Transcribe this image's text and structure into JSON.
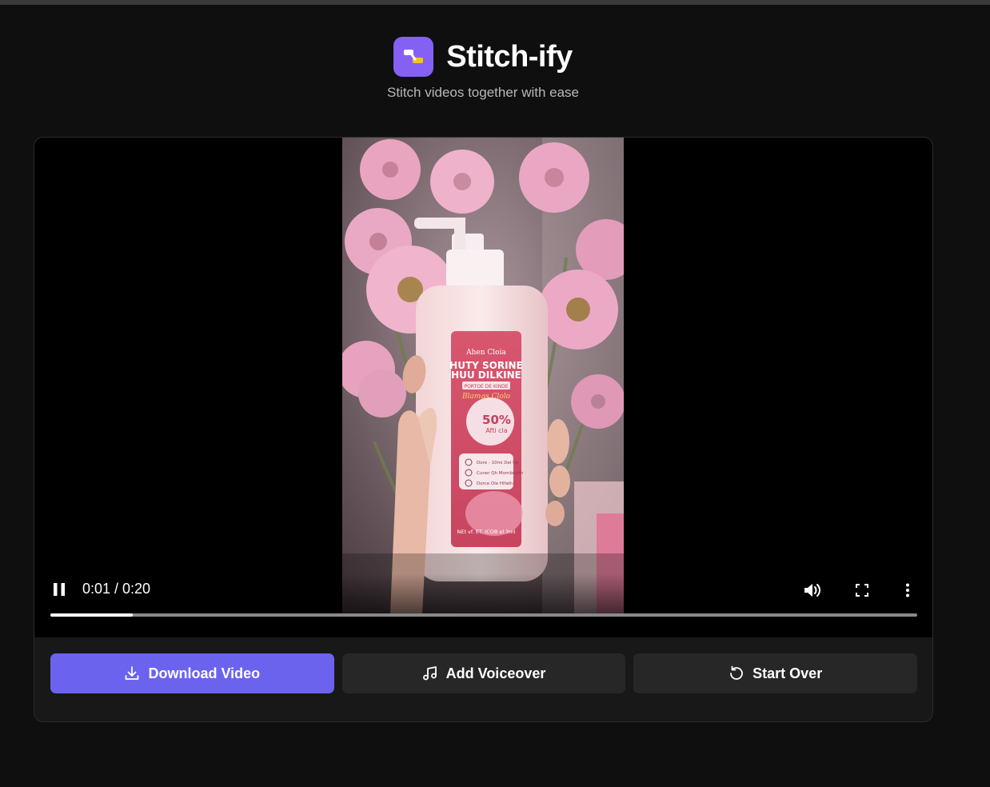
{
  "app": {
    "title": "Stitch-ify",
    "subtitle": "Stitch videos together with ease",
    "logo_icon": "stitch-logo-icon",
    "accent_color": "#8461f2"
  },
  "player": {
    "current_time": "0:01",
    "duration": "0:20",
    "time_display": "0:01 / 0:20",
    "progress_fraction": 0.095,
    "state": "playing",
    "controls": {
      "pause_icon": "pause-icon",
      "volume_icon": "volume-icon",
      "fullscreen_icon": "fullscreen-icon",
      "more_icon": "more-vertical-icon"
    },
    "video_frame": {
      "label_brand": "Ahen Cloia",
      "label_title_line1": "HUTY SORINE",
      "label_title_line2": "HUU DILKINE",
      "label_sub": "PORTOE DE KINDE",
      "label_script": "Blamgs Clolo",
      "label_badge_top": "50%",
      "label_badge_bottom": "Afti cla",
      "label_checks": [
        "Dore - 10mi Del Up",
        "Cuner Qh Mornbestin",
        "Dorce Ole Hifathi"
      ],
      "label_footer": "NEt vf. ET. ICOB el 3ml"
    }
  },
  "actions": {
    "download": {
      "label": "Download Video",
      "icon": "download-icon",
      "color": "#6b63ee"
    },
    "voiceover": {
      "label": "Add Voiceover",
      "icon": "music-note-icon"
    },
    "start_over": {
      "label": "Start Over",
      "icon": "rotate-ccw-icon"
    }
  }
}
